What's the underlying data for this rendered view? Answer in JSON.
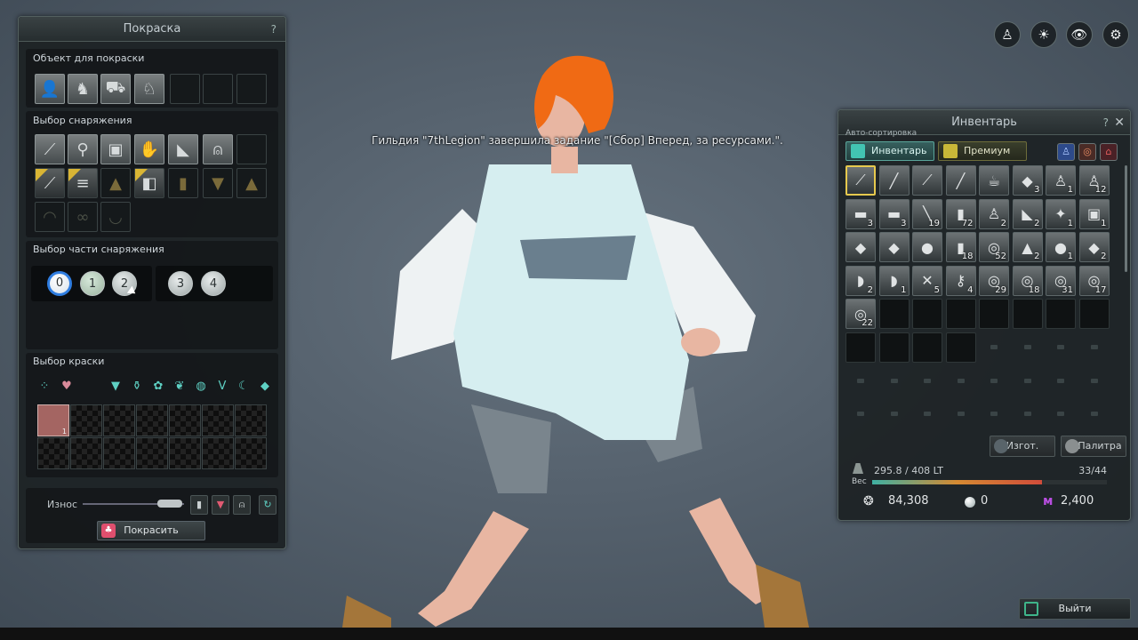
{
  "notice": "Гильдия \"7thLegion\" завершила задание \"[Сбор] Вперед, за ресурсами.\".",
  "paint_panel": {
    "title": "Покраска",
    "help": "?",
    "object_section": "Объект для покраски",
    "object_icons": [
      "character-icon",
      "horse-icon",
      "carriage-icon",
      "ship-icon"
    ],
    "equipment_section": "Выбор снаряжения",
    "part_section": "Выбор части снаряжения",
    "parts_left": [
      "0",
      "1",
      "2"
    ],
    "parts_right": [
      "3",
      "4"
    ],
    "dye_section": "Выбор краски",
    "dye_selected_color": "#a46562",
    "dye_selected_count": "1",
    "wear_label": "Износ",
    "paint_button": "Покрасить"
  },
  "inventory": {
    "autosort": "Авто-сортировка",
    "title": "Инвентарь",
    "help": "?",
    "close": "✕",
    "tab_inventory": "Инвентарь",
    "tab_premium": "Премиум",
    "rows": [
      [
        {
          "icon": "⟋",
          "q": ""
        },
        {
          "icon": "╱",
          "q": ""
        },
        {
          "icon": "⟋",
          "q": ""
        },
        {
          "icon": "╱",
          "q": ""
        },
        {
          "icon": "☕",
          "q": ""
        },
        {
          "icon": "◆",
          "q": "3"
        },
        {
          "icon": "♙",
          "q": "1"
        },
        {
          "icon": "♙",
          "q": "12"
        }
      ],
      [
        {
          "icon": "▬",
          "q": "3"
        },
        {
          "icon": "▬",
          "q": "3"
        },
        {
          "icon": "╲",
          "q": "19"
        },
        {
          "icon": "▮",
          "q": "72"
        },
        {
          "icon": "♙",
          "q": "2"
        },
        {
          "icon": "◣",
          "q": "2"
        },
        {
          "icon": "✦",
          "q": "1"
        },
        {
          "icon": "▣",
          "q": "1"
        }
      ],
      [
        {
          "icon": "◆",
          "q": ""
        },
        {
          "icon": "◆",
          "q": ""
        },
        {
          "icon": "●",
          "q": ""
        },
        {
          "icon": "▮",
          "q": "18"
        },
        {
          "icon": "◎",
          "q": "52"
        },
        {
          "icon": "▲",
          "q": "2"
        },
        {
          "icon": "●",
          "q": "1"
        },
        {
          "icon": "◆",
          "q": "2"
        }
      ],
      [
        {
          "icon": "◗",
          "q": "2"
        },
        {
          "icon": "◗",
          "q": "1"
        },
        {
          "icon": "✕",
          "q": "5"
        },
        {
          "icon": "⚷",
          "q": "4"
        },
        {
          "icon": "◎",
          "q": "29"
        },
        {
          "icon": "◎",
          "q": "18"
        },
        {
          "icon": "◎",
          "q": "31"
        },
        {
          "icon": "◎",
          "q": "17"
        }
      ],
      [
        {
          "icon": "◎",
          "q": "22"
        }
      ]
    ],
    "craft_button": "Изгот.",
    "palette_button": "Палитра",
    "weight": "295.8 / 408 LT",
    "weight_label": "Вес",
    "weight_fraction": 0.725,
    "slots": "33/44",
    "silver": "84,308",
    "pearls": "0",
    "cp": "2,400"
  },
  "exit_button": "Выйти"
}
